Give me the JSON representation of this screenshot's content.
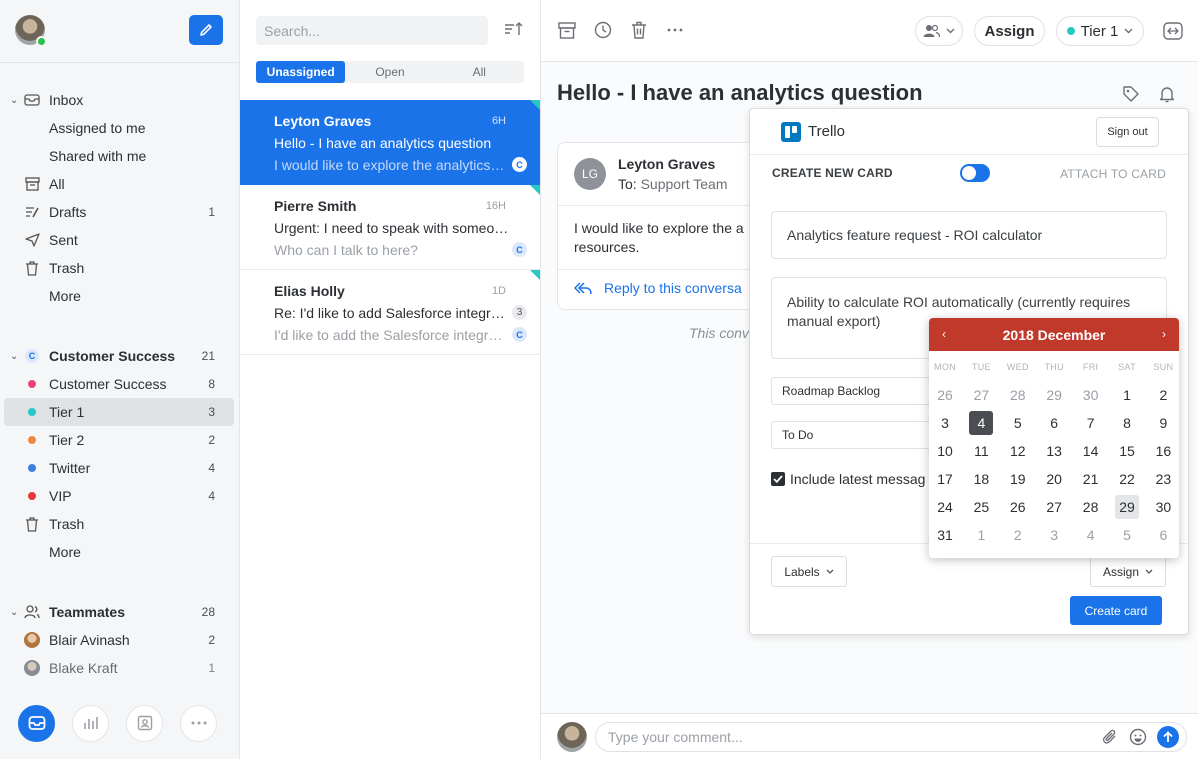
{
  "sidebar": {
    "inbox": {
      "label": "Inbox"
    },
    "items": [
      {
        "label": "Assigned to me"
      },
      {
        "label": "Shared with me"
      },
      {
        "label": "All"
      },
      {
        "label": "Drafts",
        "count": "1"
      },
      {
        "label": "Sent"
      },
      {
        "label": "Trash"
      },
      {
        "label": "More"
      }
    ],
    "team": {
      "label": "Customer Success",
      "count": "21",
      "badge": "C"
    },
    "team_items": [
      {
        "label": "Customer Success",
        "count": "8",
        "color": "#e8447a"
      },
      {
        "label": "Tier 1",
        "count": "3",
        "color": "#27c9c5"
      },
      {
        "label": "Tier 2",
        "count": "2",
        "color": "#f0883e"
      },
      {
        "label": "Twitter",
        "count": "4",
        "color": "#3b82e0"
      },
      {
        "label": "VIP",
        "count": "4",
        "color": "#e53935"
      },
      {
        "label": "Trash"
      },
      {
        "label": "More"
      }
    ],
    "teammates": {
      "label": "Teammates",
      "count": "28"
    },
    "teammate_items": [
      {
        "label": "Blair Avinash",
        "count": "2"
      },
      {
        "label": "Blake Kraft",
        "count": "1"
      }
    ]
  },
  "list": {
    "search_placeholder": "Search...",
    "tabs": [
      "Unassigned",
      "Open",
      "All"
    ],
    "conversations": [
      {
        "name": "Leyton Graves",
        "time": "6H",
        "subject": "Hello - I have an analytics question",
        "preview": "I would like to explore the analytics feature",
        "badge": "C"
      },
      {
        "name": "Pierre Smith",
        "time": "16H",
        "subject": "Urgent: I need to speak with someone ASAP",
        "preview": "Who can I talk to here?",
        "badge": "C"
      },
      {
        "name": "Elias Holly",
        "time": "1D",
        "subject": "Re: I'd like to add Salesforce integration",
        "preview": "I'd like to add the Salesforce integration to",
        "badge": "C",
        "count": "3"
      }
    ]
  },
  "main": {
    "assign_label": "Assign",
    "tier_label": "Tier 1",
    "title": "Hello - I have an analytics question",
    "message": {
      "avatar": "LG",
      "from": "Leyton Graves",
      "to_label": "To:",
      "to": "Support Team",
      "body": "I would like to explore the a\nresources.",
      "reply": "Reply to this conversa"
    },
    "conv_note": "This conv",
    "comment_placeholder": "Type your comment..."
  },
  "trello": {
    "name": "Trello",
    "signout": "Sign out",
    "create_label": "CREATE NEW CARD",
    "attach_label": "ATTACH TO CARD",
    "card_title": "Analytics feature request - ROI calculator",
    "card_desc": "Ability to calculate ROI automatically (currently requires manual export)",
    "board": "Roadmap Backlog",
    "list": "To Do",
    "include": "Include latest messag",
    "labels_btn": "Labels",
    "assign_btn": "Assign",
    "create_btn": "Create card"
  },
  "calendar": {
    "month": "2018 December",
    "weekdays": [
      "MON",
      "TUE",
      "WED",
      "THU",
      "FRI",
      "SAT",
      "SUN"
    ],
    "weeks": [
      [
        "26",
        "27",
        "28",
        "29",
        "30",
        "1",
        "2"
      ],
      [
        "3",
        "4",
        "5",
        "6",
        "7",
        "8",
        "9"
      ],
      [
        "10",
        "11",
        "12",
        "13",
        "14",
        "15",
        "16"
      ],
      [
        "17",
        "18",
        "19",
        "20",
        "21",
        "22",
        "23"
      ],
      [
        "24",
        "25",
        "26",
        "27",
        "28",
        "29",
        "30"
      ],
      [
        "31",
        "1",
        "2",
        "3",
        "4",
        "5",
        "6"
      ]
    ],
    "selected": "4",
    "today": "29",
    "accent": "#c0392b"
  },
  "colors": {
    "primary": "#1a73e8",
    "tier1": "#27c9c5"
  }
}
